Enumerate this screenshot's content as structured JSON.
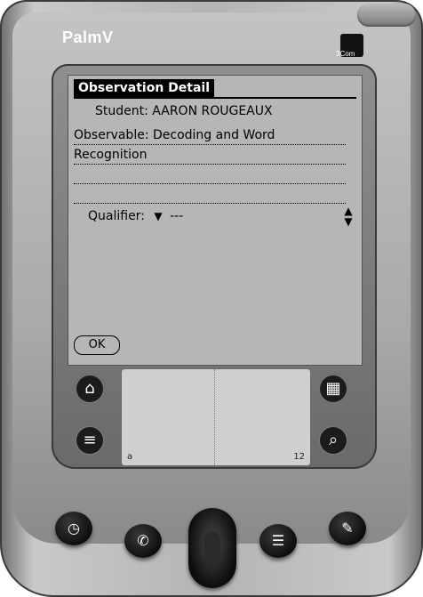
{
  "device": {
    "brand": "PalmV",
    "ir_label": "3Com"
  },
  "form": {
    "title": "Observation Detail",
    "student": "Student: AARON ROUGEAUX",
    "observable_line1": "Observable: Decoding and Word",
    "observable_line2": "Recognition",
    "qualifier_label": "Qualifier:",
    "qualifier_value": "---",
    "ok_label": "OK"
  },
  "silkscreen": {
    "buttons": [
      "home-icon",
      "menu-icon",
      "calculator-icon",
      "find-icon"
    ],
    "graffiti_left_mark": "a",
    "graffiti_right_mark": "12"
  },
  "hardware": {
    "buttons": [
      "datebook-icon",
      "phone-icon",
      "scroll-icon",
      "todo-icon",
      "memo-icon"
    ]
  }
}
